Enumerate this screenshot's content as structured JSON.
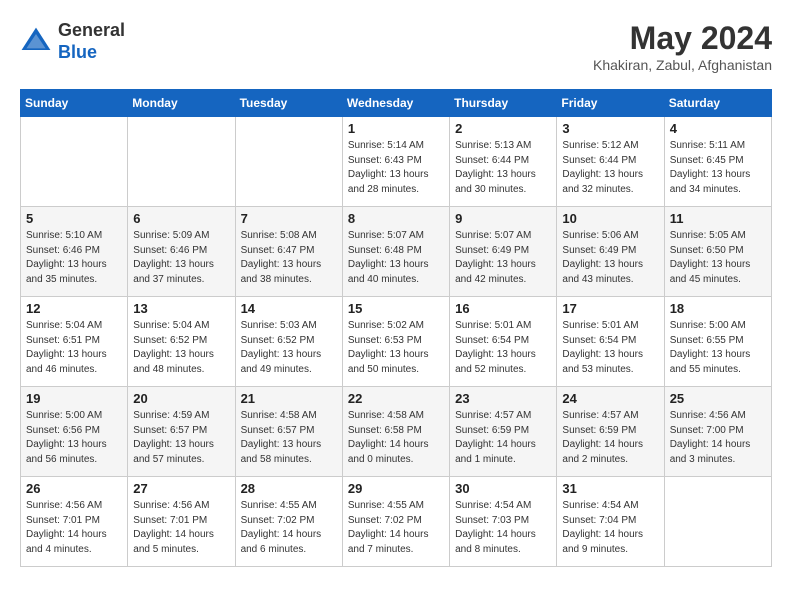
{
  "header": {
    "logo": {
      "line1": "General",
      "line2": "Blue"
    },
    "title": "May 2024",
    "location": "Khakiran, Zabul, Afghanistan"
  },
  "calendar": {
    "weekdays": [
      "Sunday",
      "Monday",
      "Tuesday",
      "Wednesday",
      "Thursday",
      "Friday",
      "Saturday"
    ],
    "weeks": [
      [
        {
          "day": "",
          "sunrise": "",
          "sunset": "",
          "daylight": ""
        },
        {
          "day": "",
          "sunrise": "",
          "sunset": "",
          "daylight": ""
        },
        {
          "day": "",
          "sunrise": "",
          "sunset": "",
          "daylight": ""
        },
        {
          "day": "1",
          "sunrise": "Sunrise: 5:14 AM",
          "sunset": "Sunset: 6:43 PM",
          "daylight": "Daylight: 13 hours and 28 minutes."
        },
        {
          "day": "2",
          "sunrise": "Sunrise: 5:13 AM",
          "sunset": "Sunset: 6:44 PM",
          "daylight": "Daylight: 13 hours and 30 minutes."
        },
        {
          "day": "3",
          "sunrise": "Sunrise: 5:12 AM",
          "sunset": "Sunset: 6:44 PM",
          "daylight": "Daylight: 13 hours and 32 minutes."
        },
        {
          "day": "4",
          "sunrise": "Sunrise: 5:11 AM",
          "sunset": "Sunset: 6:45 PM",
          "daylight": "Daylight: 13 hours and 34 minutes."
        }
      ],
      [
        {
          "day": "5",
          "sunrise": "Sunrise: 5:10 AM",
          "sunset": "Sunset: 6:46 PM",
          "daylight": "Daylight: 13 hours and 35 minutes."
        },
        {
          "day": "6",
          "sunrise": "Sunrise: 5:09 AM",
          "sunset": "Sunset: 6:46 PM",
          "daylight": "Daylight: 13 hours and 37 minutes."
        },
        {
          "day": "7",
          "sunrise": "Sunrise: 5:08 AM",
          "sunset": "Sunset: 6:47 PM",
          "daylight": "Daylight: 13 hours and 38 minutes."
        },
        {
          "day": "8",
          "sunrise": "Sunrise: 5:07 AM",
          "sunset": "Sunset: 6:48 PM",
          "daylight": "Daylight: 13 hours and 40 minutes."
        },
        {
          "day": "9",
          "sunrise": "Sunrise: 5:07 AM",
          "sunset": "Sunset: 6:49 PM",
          "daylight": "Daylight: 13 hours and 42 minutes."
        },
        {
          "day": "10",
          "sunrise": "Sunrise: 5:06 AM",
          "sunset": "Sunset: 6:49 PM",
          "daylight": "Daylight: 13 hours and 43 minutes."
        },
        {
          "day": "11",
          "sunrise": "Sunrise: 5:05 AM",
          "sunset": "Sunset: 6:50 PM",
          "daylight": "Daylight: 13 hours and 45 minutes."
        }
      ],
      [
        {
          "day": "12",
          "sunrise": "Sunrise: 5:04 AM",
          "sunset": "Sunset: 6:51 PM",
          "daylight": "Daylight: 13 hours and 46 minutes."
        },
        {
          "day": "13",
          "sunrise": "Sunrise: 5:04 AM",
          "sunset": "Sunset: 6:52 PM",
          "daylight": "Daylight: 13 hours and 48 minutes."
        },
        {
          "day": "14",
          "sunrise": "Sunrise: 5:03 AM",
          "sunset": "Sunset: 6:52 PM",
          "daylight": "Daylight: 13 hours and 49 minutes."
        },
        {
          "day": "15",
          "sunrise": "Sunrise: 5:02 AM",
          "sunset": "Sunset: 6:53 PM",
          "daylight": "Daylight: 13 hours and 50 minutes."
        },
        {
          "day": "16",
          "sunrise": "Sunrise: 5:01 AM",
          "sunset": "Sunset: 6:54 PM",
          "daylight": "Daylight: 13 hours and 52 minutes."
        },
        {
          "day": "17",
          "sunrise": "Sunrise: 5:01 AM",
          "sunset": "Sunset: 6:54 PM",
          "daylight": "Daylight: 13 hours and 53 minutes."
        },
        {
          "day": "18",
          "sunrise": "Sunrise: 5:00 AM",
          "sunset": "Sunset: 6:55 PM",
          "daylight": "Daylight: 13 hours and 55 minutes."
        }
      ],
      [
        {
          "day": "19",
          "sunrise": "Sunrise: 5:00 AM",
          "sunset": "Sunset: 6:56 PM",
          "daylight": "Daylight: 13 hours and 56 minutes."
        },
        {
          "day": "20",
          "sunrise": "Sunrise: 4:59 AM",
          "sunset": "Sunset: 6:57 PM",
          "daylight": "Daylight: 13 hours and 57 minutes."
        },
        {
          "day": "21",
          "sunrise": "Sunrise: 4:58 AM",
          "sunset": "Sunset: 6:57 PM",
          "daylight": "Daylight: 13 hours and 58 minutes."
        },
        {
          "day": "22",
          "sunrise": "Sunrise: 4:58 AM",
          "sunset": "Sunset: 6:58 PM",
          "daylight": "Daylight: 14 hours and 0 minutes."
        },
        {
          "day": "23",
          "sunrise": "Sunrise: 4:57 AM",
          "sunset": "Sunset: 6:59 PM",
          "daylight": "Daylight: 14 hours and 1 minute."
        },
        {
          "day": "24",
          "sunrise": "Sunrise: 4:57 AM",
          "sunset": "Sunset: 6:59 PM",
          "daylight": "Daylight: 14 hours and 2 minutes."
        },
        {
          "day": "25",
          "sunrise": "Sunrise: 4:56 AM",
          "sunset": "Sunset: 7:00 PM",
          "daylight": "Daylight: 14 hours and 3 minutes."
        }
      ],
      [
        {
          "day": "26",
          "sunrise": "Sunrise: 4:56 AM",
          "sunset": "Sunset: 7:01 PM",
          "daylight": "Daylight: 14 hours and 4 minutes."
        },
        {
          "day": "27",
          "sunrise": "Sunrise: 4:56 AM",
          "sunset": "Sunset: 7:01 PM",
          "daylight": "Daylight: 14 hours and 5 minutes."
        },
        {
          "day": "28",
          "sunrise": "Sunrise: 4:55 AM",
          "sunset": "Sunset: 7:02 PM",
          "daylight": "Daylight: 14 hours and 6 minutes."
        },
        {
          "day": "29",
          "sunrise": "Sunrise: 4:55 AM",
          "sunset": "Sunset: 7:02 PM",
          "daylight": "Daylight: 14 hours and 7 minutes."
        },
        {
          "day": "30",
          "sunrise": "Sunrise: 4:54 AM",
          "sunset": "Sunset: 7:03 PM",
          "daylight": "Daylight: 14 hours and 8 minutes."
        },
        {
          "day": "31",
          "sunrise": "Sunrise: 4:54 AM",
          "sunset": "Sunset: 7:04 PM",
          "daylight": "Daylight: 14 hours and 9 minutes."
        },
        {
          "day": "",
          "sunrise": "",
          "sunset": "",
          "daylight": ""
        }
      ]
    ]
  }
}
